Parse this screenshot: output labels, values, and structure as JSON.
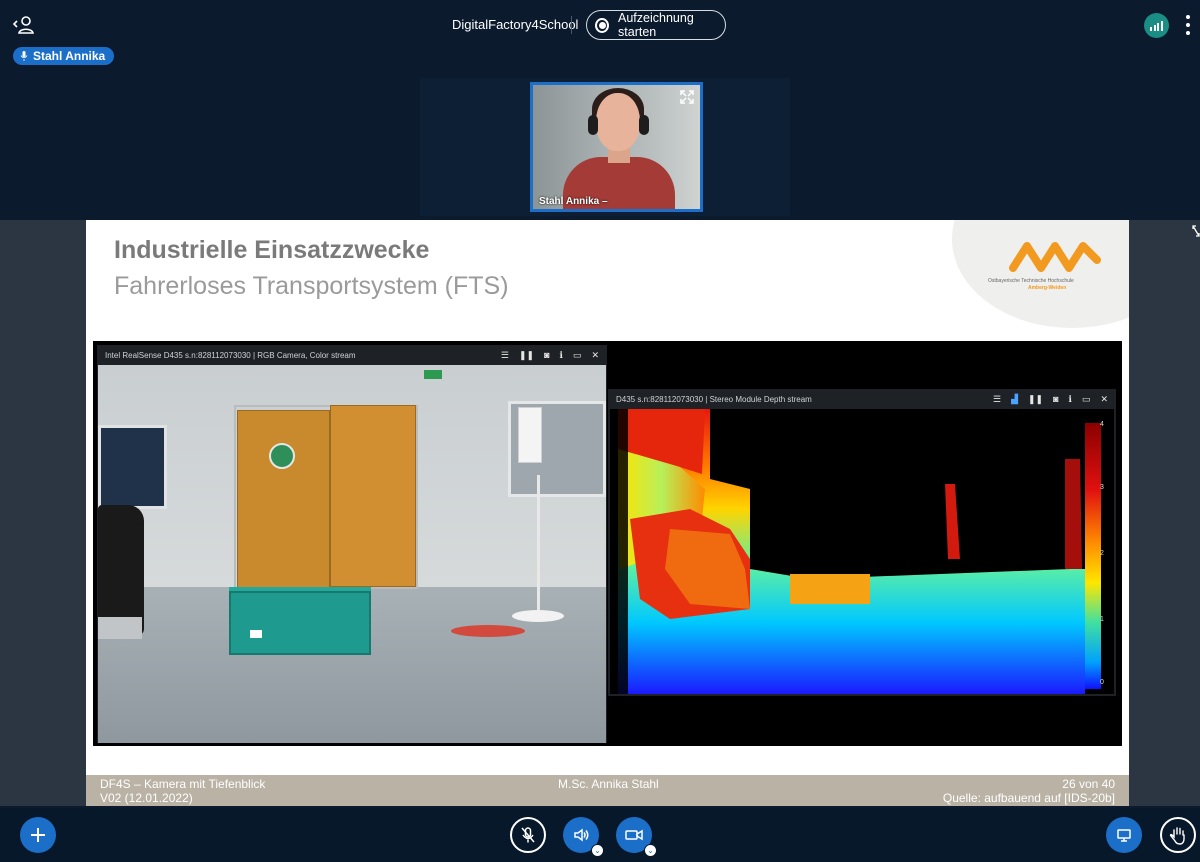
{
  "header": {
    "meeting_title": "DigitalFactory4School",
    "record_label": "Aufzeichnung starten"
  },
  "talking_indicator": {
    "name": "Stahl Annika"
  },
  "webcam": {
    "name_label": "Stahl Annika –"
  },
  "slide": {
    "title": "Industrielle Einsatzzwecke",
    "subtitle": "Fahrerloses Transportsystem (FTS)",
    "logo_line1": "Ostbayerische Technische Hochschule",
    "logo_line2": "Amberg-Weiden",
    "rgb_window_title": "Intel RealSense D435 s.n:828112073030 | RGB Camera, Color stream",
    "depth_window_title": "D435 s.n:828112073030 | Stereo Module Depth stream",
    "depth_scale_ticks": [
      "4",
      "3",
      "2",
      "1",
      "0"
    ],
    "crate_floor_marker_text": "",
    "footer": {
      "top_left": "DF4S – Kamera mit Tiefenblick",
      "bottom_left": "V02 (12.01.2022)",
      "center": "M.Sc. Annika Stahl",
      "top_right": "26 von 40",
      "bottom_right": "Quelle: aufbauend auf [IDS-20b]"
    }
  },
  "colors": {
    "accent": "#1b6fc9",
    "background": "#0b1a2d",
    "signal": "#1a8d85",
    "logo_orange": "#f29a1f",
    "slide_footer": "#b9b2a5"
  },
  "icons": {
    "user_list": "user-list-icon",
    "record": "record-icon",
    "connection": "connection-status-icon",
    "options": "kebab-menu-icon",
    "actions": "plus-icon",
    "mic": "muted-microphone-icon",
    "audio": "speaker-icon",
    "video": "camera-icon",
    "screen_share": "screen-share-icon",
    "raise_hand": "hand-icon"
  }
}
